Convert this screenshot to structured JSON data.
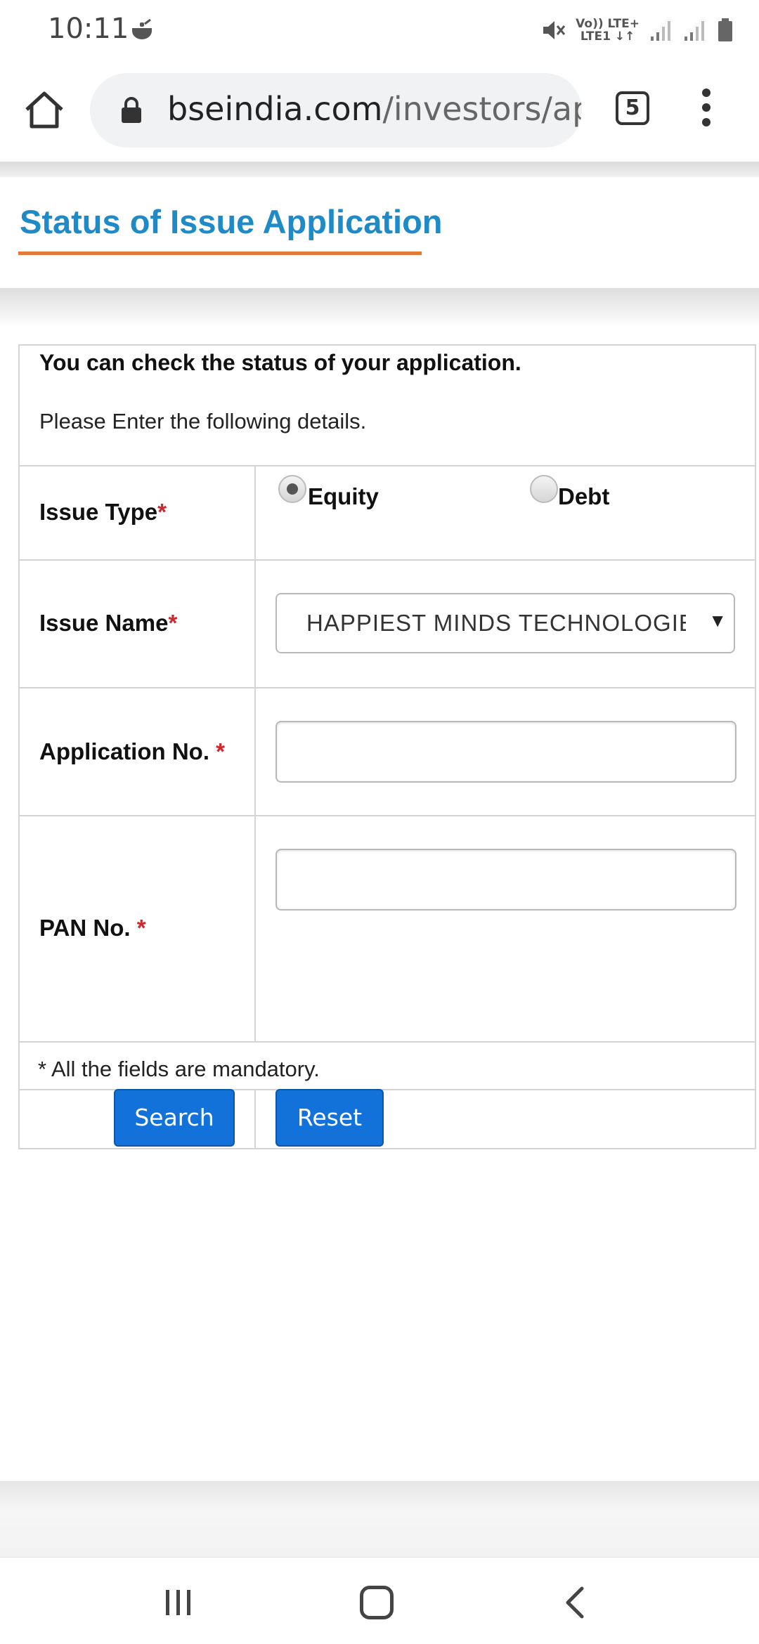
{
  "status_bar": {
    "time": "10:11",
    "app_icon": "cooking-pot-icon",
    "network_line1": "Vo)) LTE+",
    "network_line2": "LTE1 ↓↑",
    "icons": [
      "mute-icon",
      "signal-icon",
      "signal-icon",
      "battery-icon"
    ]
  },
  "browser": {
    "url_domain": "bseindia.com",
    "url_path": "/investors/app",
    "tab_count": "5",
    "icons": [
      "home-icon",
      "lock-icon",
      "tabs-icon",
      "more-vert-icon"
    ]
  },
  "page": {
    "title": "Status of Issue Application",
    "title_color": "#1e8ac8",
    "underline_color": "#e07b39"
  },
  "form": {
    "intro_bold": "You can check the status of your application.",
    "intro_text": "Please Enter the following details.",
    "issue_type_label": "Issue Type",
    "issue_name_label": "Issue Name",
    "application_no_label": "Application No. ",
    "pan_no_label": "PAN No. ",
    "required_mark": "*",
    "radio_equity": "Equity",
    "radio_debt": "Debt",
    "selected_issue_type": "Equity",
    "issue_name_value": "HAPPIEST MINDS TECHNOLOGIES LTD",
    "application_no_value": "",
    "pan_no_value": "",
    "mandatory_note": "* All the fields are mandatory.",
    "search_label": "Search",
    "reset_label": "Reset",
    "button_color": "#1372d9",
    "required_color": "#d0262c"
  },
  "nav_bar": {
    "icons": [
      "recent-apps-icon",
      "home-nav-icon",
      "back-icon"
    ]
  }
}
